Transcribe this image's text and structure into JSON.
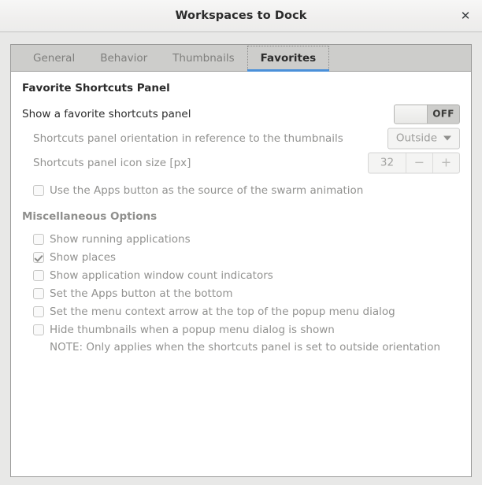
{
  "window": {
    "title": "Workspaces to Dock",
    "close_icon": "close-icon",
    "close_glyph": "✕"
  },
  "tabs": [
    {
      "label": "General",
      "active": false
    },
    {
      "label": "Behavior",
      "active": false
    },
    {
      "label": "Thumbnails",
      "active": false
    },
    {
      "label": "Favorites",
      "active": true
    }
  ],
  "favorites_panel": {
    "heading": "Favorite Shortcuts Panel",
    "show_panel": {
      "label": "Show a favorite shortcuts panel",
      "toggle_state": "OFF"
    },
    "orientation": {
      "label": "Shortcuts panel orientation in reference to the thumbnails",
      "value": "Outside",
      "caret_icon": "chevron-down-icon"
    },
    "icon_size": {
      "label": "Shortcuts panel icon size [px]",
      "value": "32",
      "decrement_glyph": "−",
      "increment_glyph": "+"
    },
    "apps_button_swarm": {
      "label": "Use the Apps button as the source of the swarm animation",
      "checked": false
    }
  },
  "misc_options": {
    "heading": "Miscellaneous Options",
    "items": [
      {
        "label": "Show running applications",
        "checked": false
      },
      {
        "label": "Show places",
        "checked": true
      },
      {
        "label": "Show application window count indicators",
        "checked": false
      },
      {
        "label": "Set the Apps button at the bottom",
        "checked": false
      },
      {
        "label": "Set the menu context arrow at the top of the popup menu dialog",
        "checked": false
      },
      {
        "label": "Hide thumbnails when a popup menu dialog is shown",
        "checked": false
      }
    ],
    "note": "NOTE: Only applies when the shortcuts panel is set to outside orientation"
  },
  "colors": {
    "accent": "#4a90d9",
    "window_bg": "#e8e8e7",
    "tabstrip_bg": "#cdcdcb",
    "content_bg": "#ffffff",
    "text": "#2b2b2b",
    "text_disabled": "#929290"
  }
}
